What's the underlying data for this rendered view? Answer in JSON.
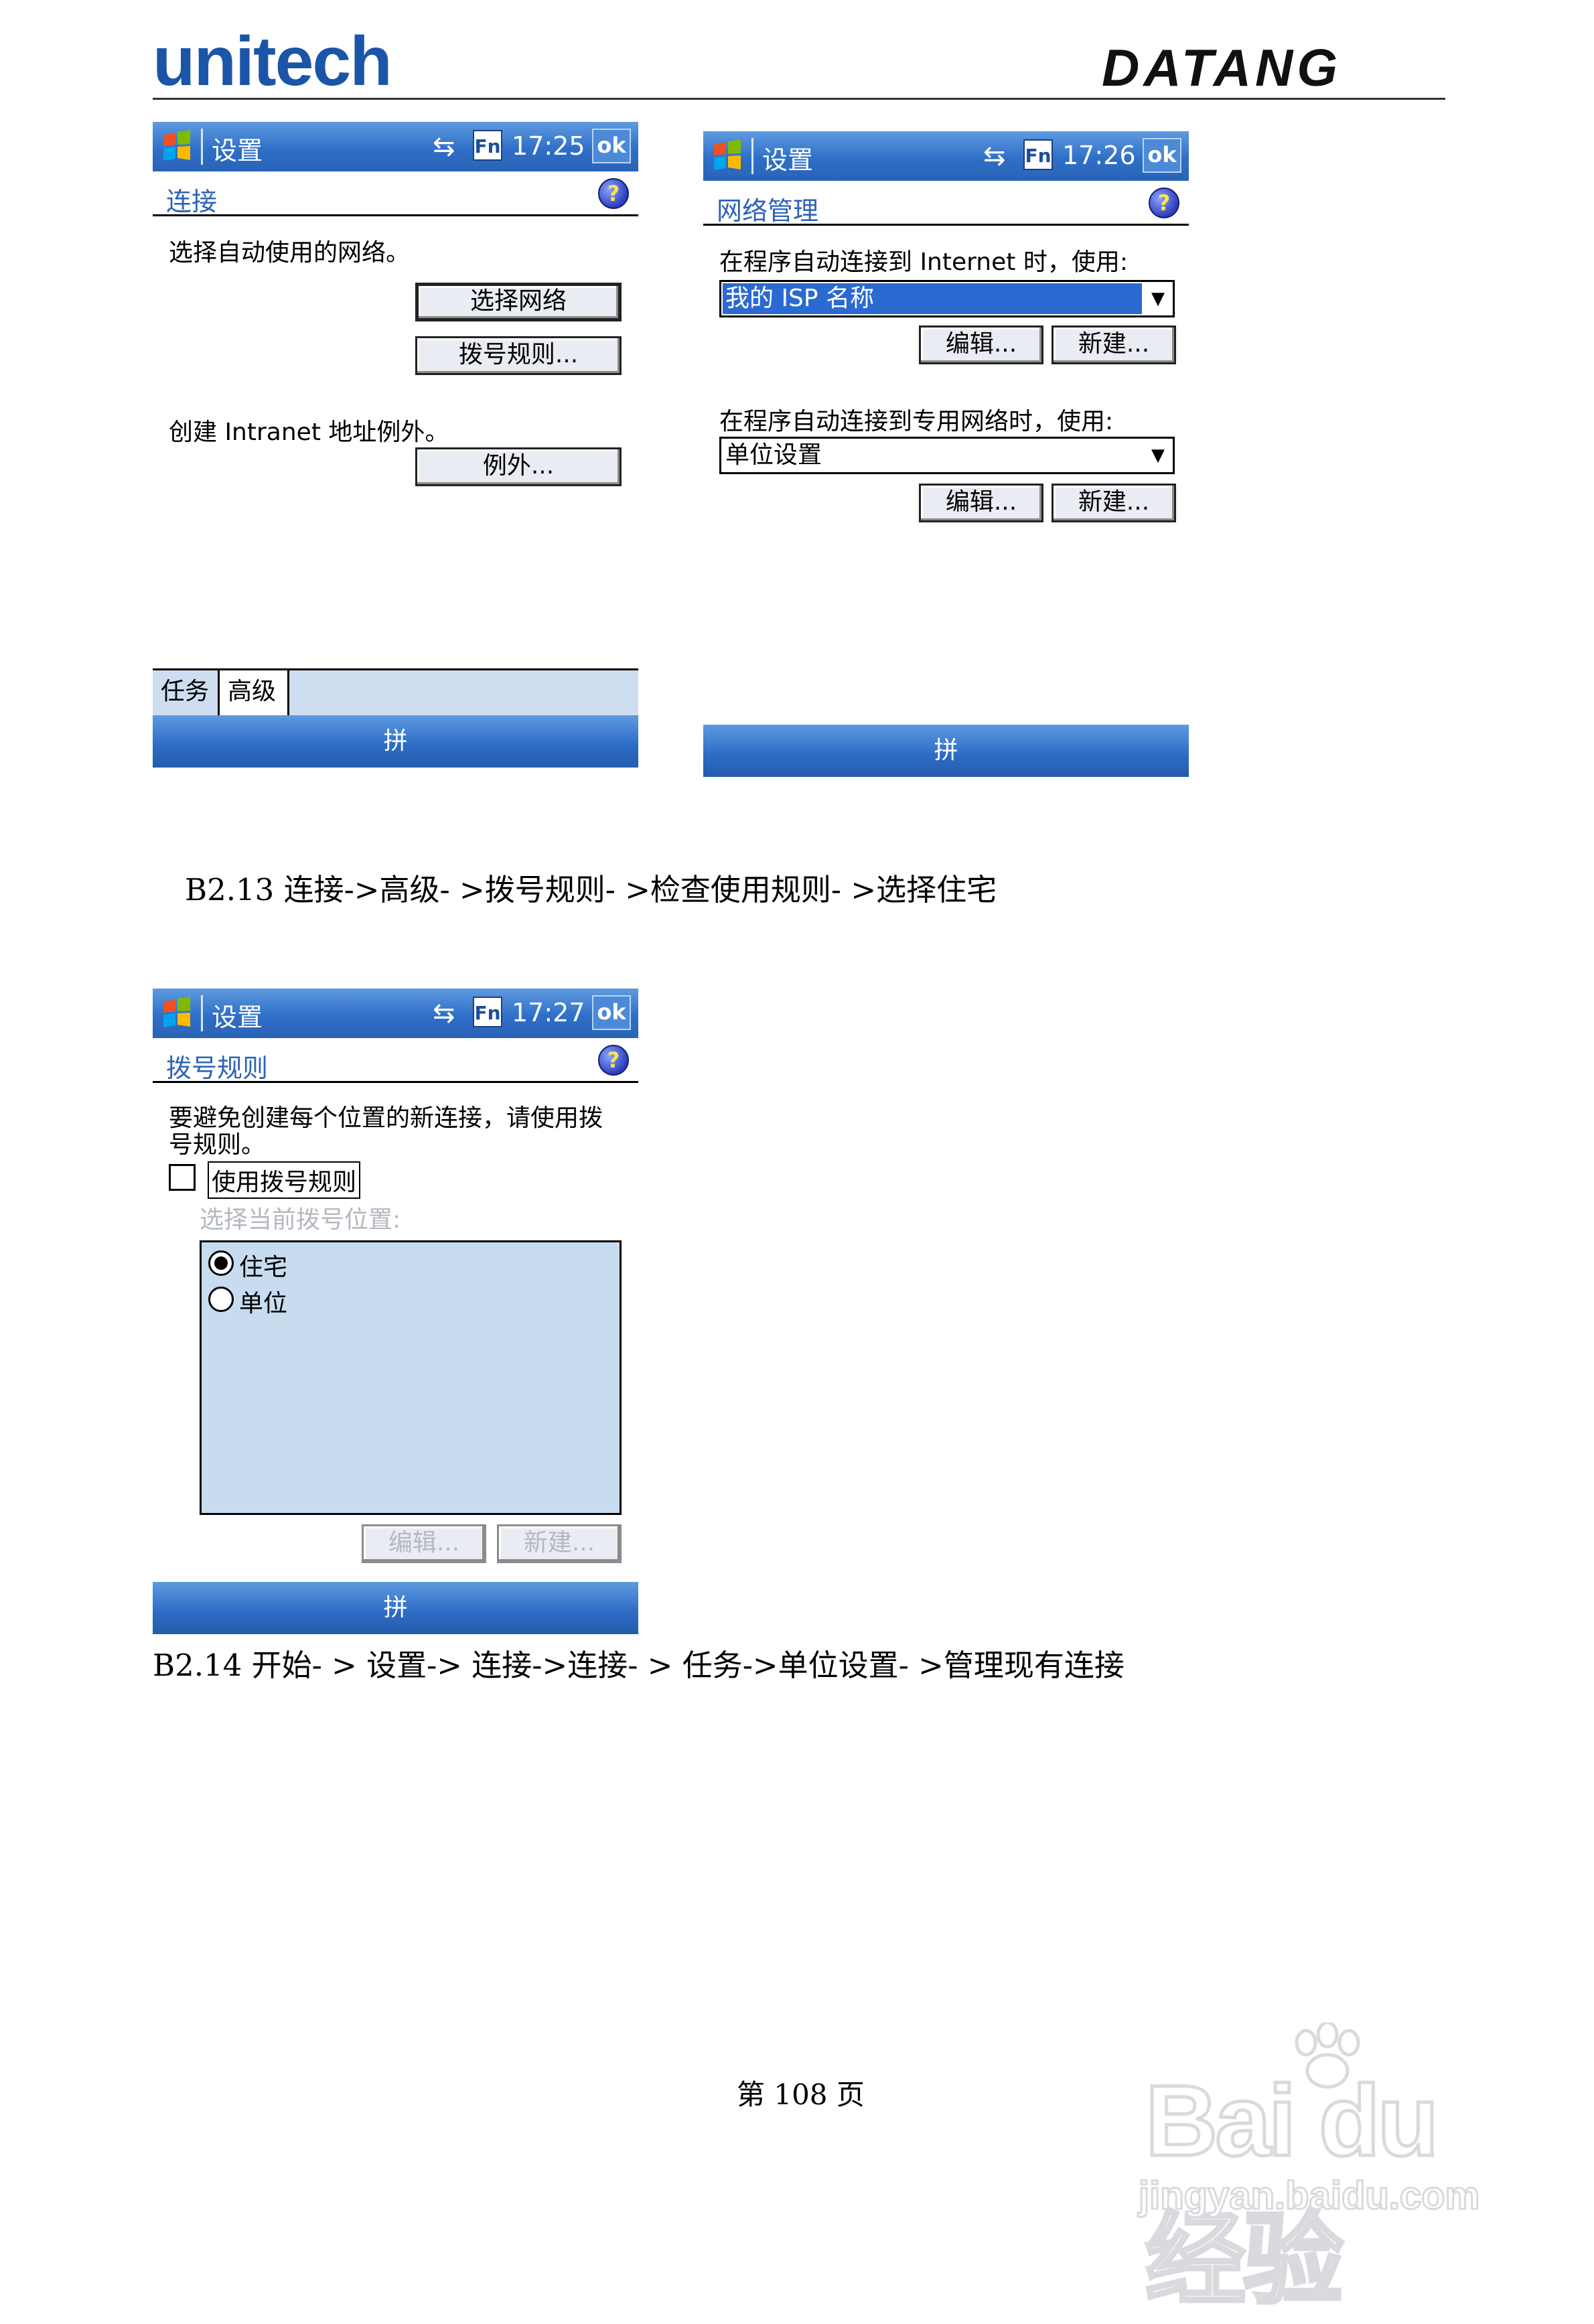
{
  "header": {
    "brand_left": "unitech",
    "brand_right": "DATANG"
  },
  "screens": {
    "s1": {
      "title": "设置",
      "time": "17:25",
      "ok": "ok",
      "fn": "Fn",
      "subheader": "连接",
      "text1": "选择自动使用的网络。",
      "btn_select_network": "选择网络",
      "btn_dial_rules": "拨号规则...",
      "text2": "创建 Intranet 地址例外。",
      "btn_exceptions": "例外...",
      "tab_tasks": "任务",
      "tab_advanced": "高级",
      "menubar": "拼"
    },
    "s2": {
      "title": "设置",
      "time": "17:26",
      "ok": "ok",
      "fn": "Fn",
      "subheader": "网络管理",
      "text_internet": "在程序自动连接到 Internet 时，使用:",
      "dd_internet": "我的 ISP 名称",
      "btn_edit": "编辑...",
      "btn_new": "新建...",
      "text_private": "在程序自动连接到专用网络时，使用:",
      "dd_private": "单位设置",
      "menubar": "拼"
    },
    "s3": {
      "title": "设置",
      "time": "17:27",
      "ok": "ok",
      "fn": "Fn",
      "subheader": "拨号规则",
      "text_line1": "要避免创建每个位置的新连接，请使用拨",
      "text_line2": "号规则。",
      "checkbox_label": "使用拨号规则",
      "select_location": "选择当前拨号位置:",
      "radio_home": "住宅",
      "radio_work": "单位",
      "btn_edit": "编辑...",
      "btn_new": "新建...",
      "menubar": "拼"
    }
  },
  "captions": {
    "b213": "B2.13 连接->高级- >拨号规则- >检查使用规则- >选择住宅",
    "b214": "B2.14 开始- > 设置-> 连接->连接- > 任务->单位设置- >管理现有连接"
  },
  "footer": {
    "page": "第 108 页"
  },
  "watermark": {
    "big": "Bai du 经验",
    "small": "jingyan.baidu.com"
  }
}
